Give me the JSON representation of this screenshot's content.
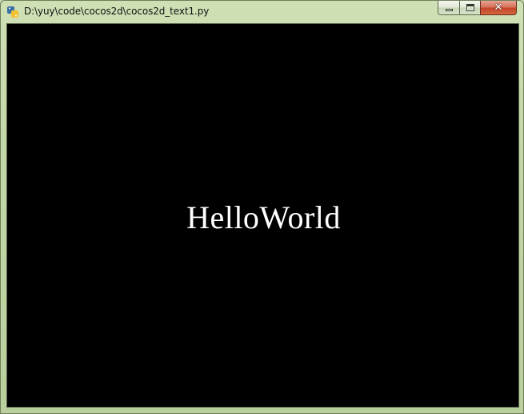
{
  "window": {
    "title": "D:\\yuy\\code\\cocos2d\\cocos2d_text1.py",
    "app_icon": "python-icon",
    "controls": {
      "minimize_icon": "minimize-icon",
      "maximize_icon": "maximize-icon",
      "close_icon": "close-icon",
      "close_glyph": "✕"
    },
    "frame_color": "#c3d6a6",
    "close_color": "#c3452a"
  },
  "scene": {
    "background_color": "#000000",
    "text_color": "#ffffff",
    "label": "HelloWorld"
  }
}
